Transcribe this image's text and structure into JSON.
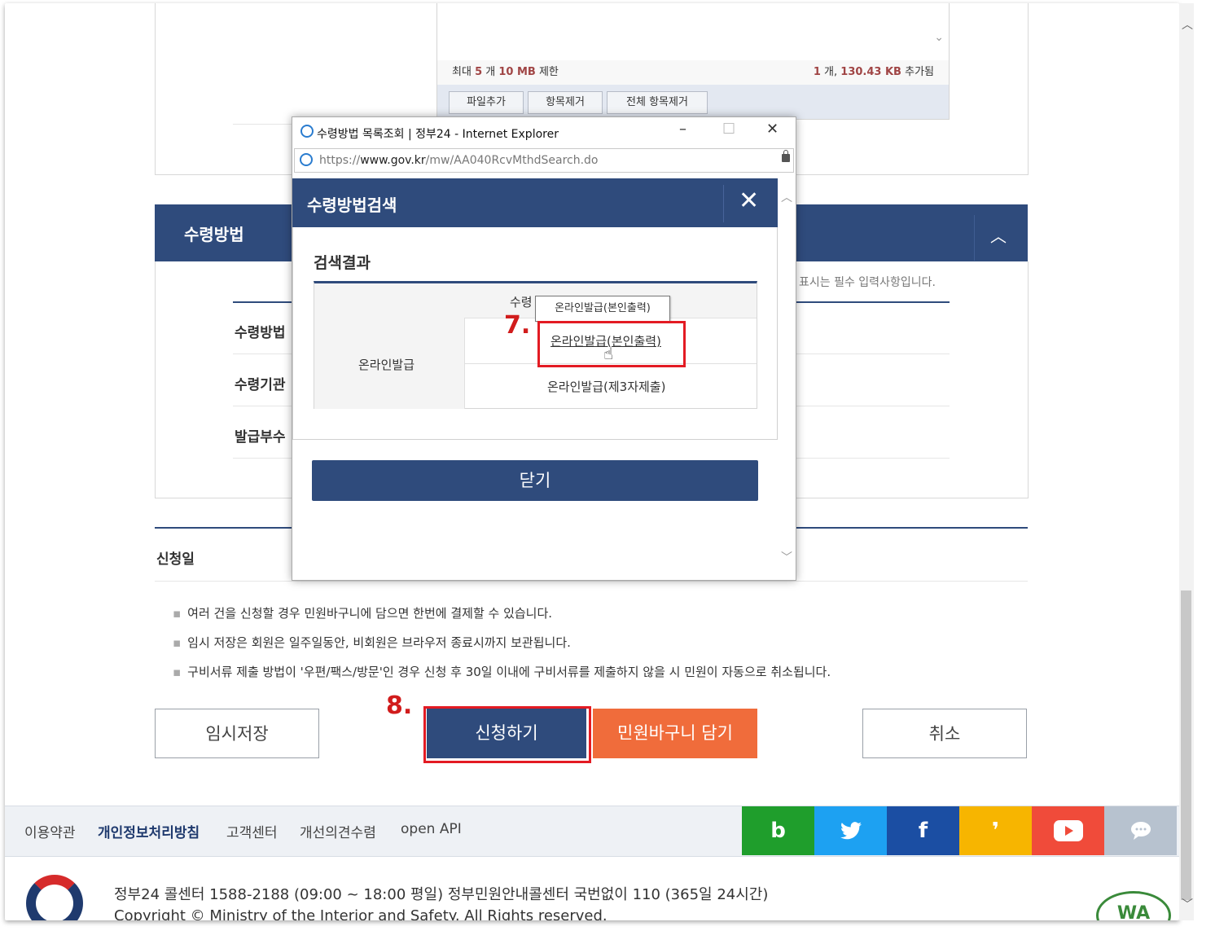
{
  "upload": {
    "info_left_prefix": "최대",
    "info_count": "5",
    "info_unit": "개",
    "info_size": "10 MB",
    "info_limit": "제한",
    "info_right_count": "1",
    "info_right_unit": "개,",
    "info_right_size": "130.43 KB",
    "info_right_suffix": "추가됨",
    "add_file": "파일추가",
    "remove_item": "항목제거",
    "remove_all": "전체 항목제거"
  },
  "receipt": {
    "title": "수령방법",
    "required_note": "표시는 필수 입력사항입니다.",
    "fields": [
      "수령방법",
      "수령기관",
      "발급부수"
    ]
  },
  "apply_date": {
    "label": "신청일"
  },
  "notes": [
    "여러 건을 신청할 경우 민원바구니에 담으면 한번에 결제할 수 있습니다.",
    "임시 저장은 회원은 일주일동안, 비회원은 브라우저 종료시까지 보관됩니다.",
    "구비서류 제출 방법이 '우편/팩스/방문'인 경우 신청 후 30일 이내에 구비서류를 제출하지 않을 시 민원이 자동으로 취소됩니다."
  ],
  "actions": {
    "temp_save": "임시저장",
    "apply": "신청하기",
    "cart": "민원바구니 담기",
    "cancel": "취소",
    "step8": "8."
  },
  "footer": {
    "links": [
      "이용약관",
      "개인정보처리방침",
      "고객센터",
      "개선의견수렴",
      "open API"
    ],
    "social": [
      "b",
      "t",
      "f",
      "s",
      "▶",
      "…"
    ],
    "social_colors": [
      "#1f9e2c",
      "#1da1f2",
      "#1b4ea3",
      "#f7b500",
      "#f04b3a",
      "#b7c2cf"
    ],
    "callcenter": "정부24 콜센터 1588-2188 (09:00 ~ 18:00 평일) 정부민원안내콜센터 국번없이 110 (365일 24시간)",
    "copyright": "Copyright © Ministry of the Interior and Safety. All Rights reserved.",
    "wa_mark": "WA"
  },
  "popup": {
    "window_title": "수령방법 목록조회 | 정부24 - Internet Explorer",
    "url_scheme": "https://",
    "url_host": "www.gov.kr",
    "url_path": "/mw/AA040RcvMthdSearch.do",
    "modal_title": "수령방법검색",
    "result_title": "검색결과",
    "table_header": "수령",
    "group_label": "온라인발급",
    "options": [
      "온라인발급(본인출력)",
      "온라인발급(제3자제출)"
    ],
    "tooltip": "온라인발급(본인출력)",
    "close": "닫기",
    "step7": "7."
  }
}
